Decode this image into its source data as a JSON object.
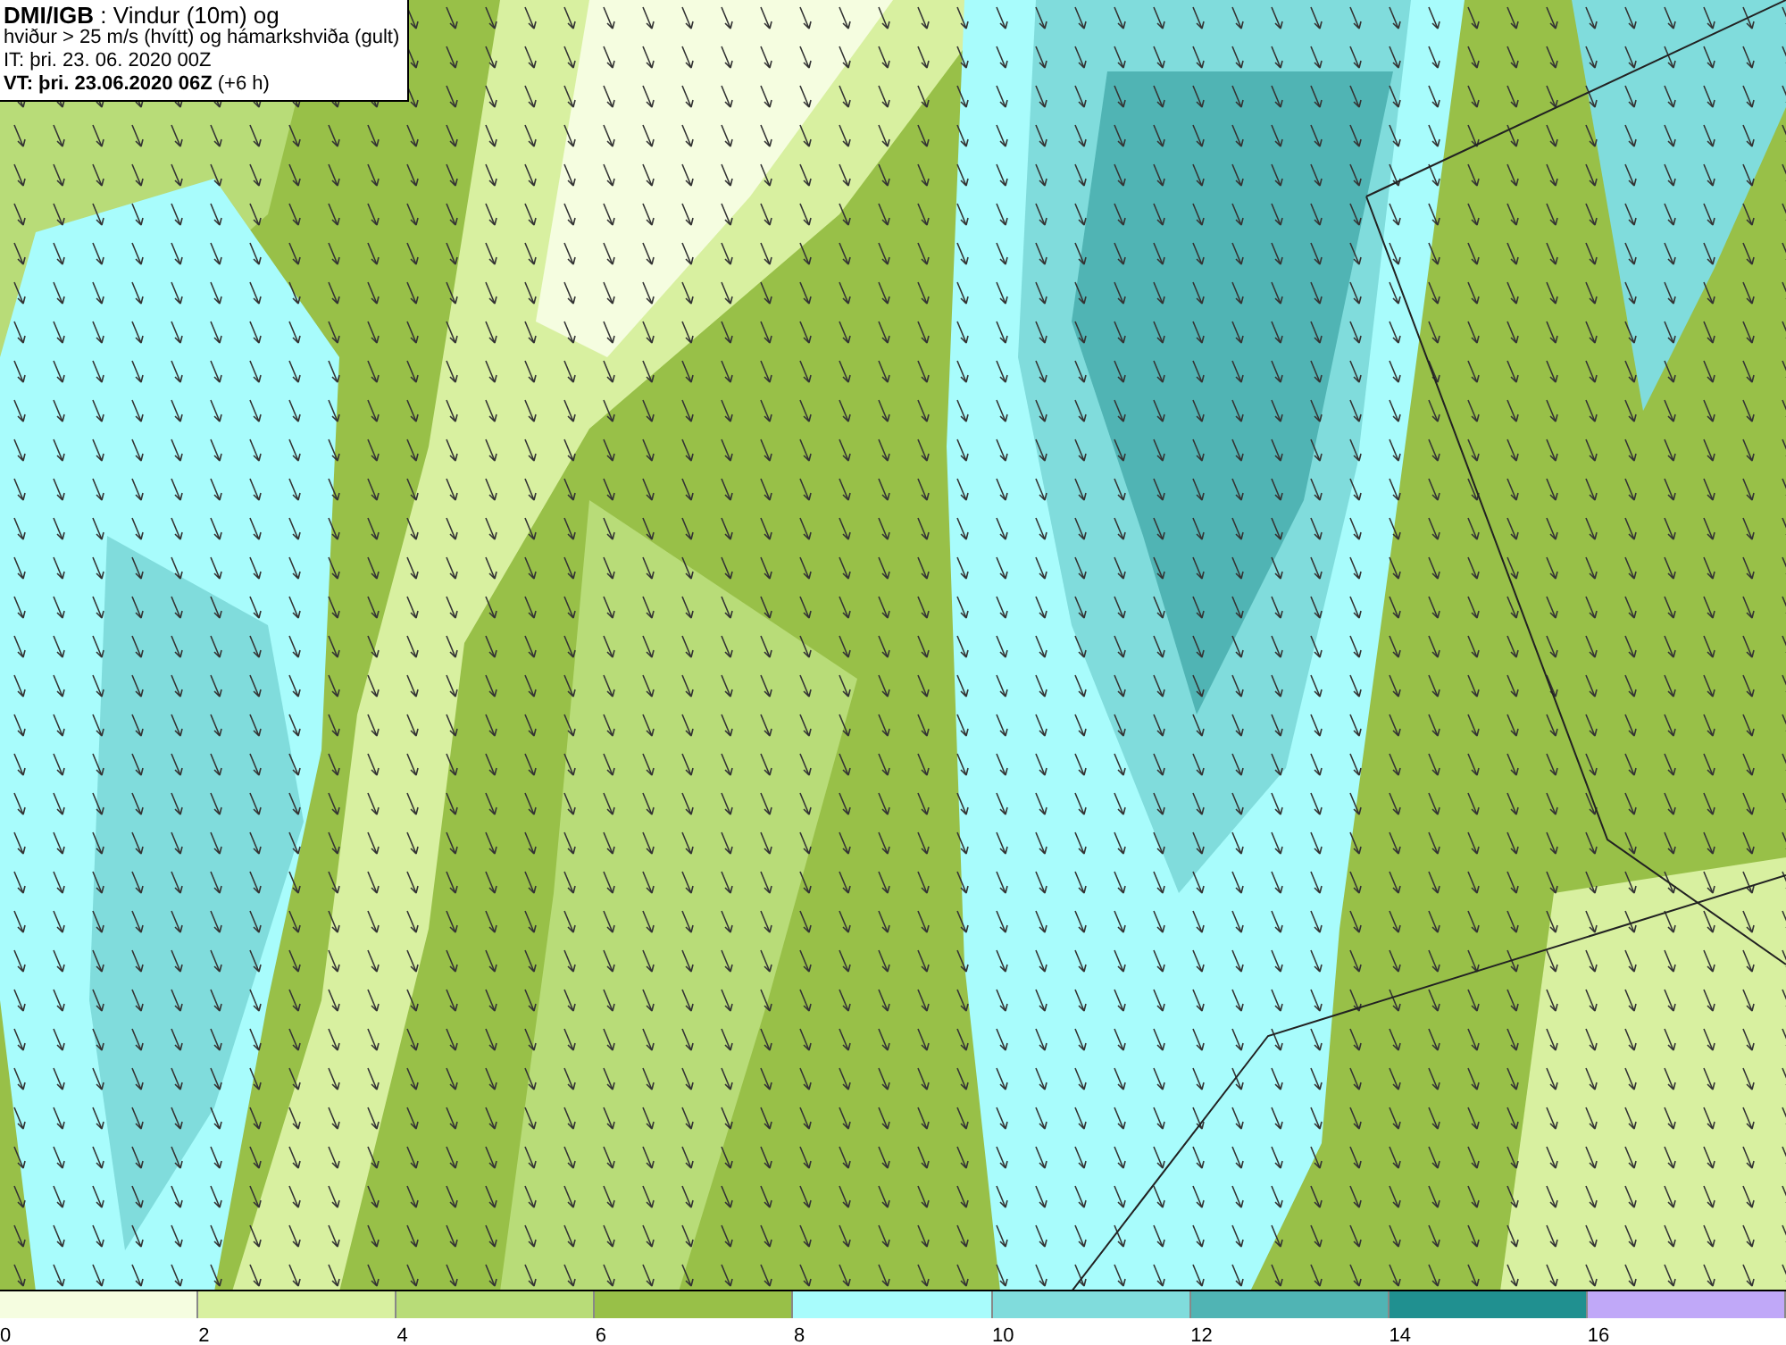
{
  "title_box": {
    "lines": [
      "**DMI/IGB** : Vindur (10m) og",
      "hviður > 25 m/s (hvítt) og hámarkshviða (gult)",
      "IT: þri. 23. 06. 2020 00Z",
      "**VT: þri. 23.06.2020 06Z** (+6 h)"
    ]
  },
  "legend": {
    "items": [
      {
        "label": "0",
        "color": "#f5fde0"
      },
      {
        "label": "2",
        "color": "#d8f0a0"
      },
      {
        "label": "4",
        "color": "#b8dc78"
      },
      {
        "label": "6",
        "color": "#98c048"
      },
      {
        "label": "8",
        "color": "#a8fcfc"
      },
      {
        "label": "10",
        "color": "#80dcdc"
      },
      {
        "label": "12",
        "color": "#50b4b4"
      },
      {
        "label": "14",
        "color": "#209090"
      },
      {
        "label": "16",
        "color": "#c0a8f8"
      }
    ]
  }
}
